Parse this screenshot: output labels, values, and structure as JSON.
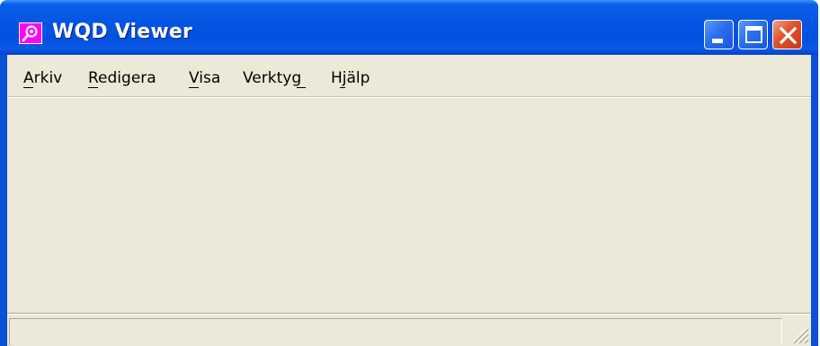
{
  "window": {
    "title": "WQD Viewer",
    "app_icon": "viewer-app-icon",
    "caption_buttons": {
      "minimize": "minimize-icon",
      "maximize": "maximize-icon",
      "close": "close-icon"
    }
  },
  "menu": {
    "items": [
      {
        "label": "Arkiv",
        "mnemonic": "A"
      },
      {
        "label": "Redigera",
        "mnemonic": "R"
      },
      {
        "label": "Visa",
        "mnemonic": "V"
      },
      {
        "label": "Verktyg",
        "mnemonic": "g"
      },
      {
        "label": "Hjälp",
        "mnemonic": "j"
      }
    ]
  },
  "statusbar": {
    "text": "",
    "grip": "size-grip-icon"
  },
  "colors": {
    "titlebar": "#0555e3",
    "client_bg": "#ece9d8",
    "close_button": "#e0522a",
    "app_icon_bg": "#ff00ff"
  }
}
